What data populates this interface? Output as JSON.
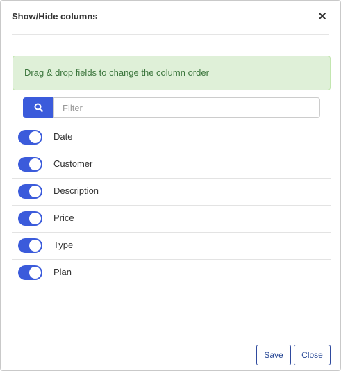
{
  "modal": {
    "title": "Show/Hide columns",
    "close_icon": "close-icon"
  },
  "alert": {
    "text": "Drag & drop fields to change the column order",
    "color": "#3c763d"
  },
  "filter": {
    "placeholder": "Filter",
    "value": "",
    "button_icon": "search-icon"
  },
  "columns": [
    {
      "label": "Date",
      "enabled": true
    },
    {
      "label": "Customer",
      "enabled": true
    },
    {
      "label": "Description",
      "enabled": true
    },
    {
      "label": "Price",
      "enabled": true
    },
    {
      "label": "Type",
      "enabled": true
    },
    {
      "label": "Plan",
      "enabled": true
    }
  ],
  "footer": {
    "save_label": "Save",
    "close_label": "Close"
  },
  "colors": {
    "accent": "#3b5bdb",
    "button_border": "#2f4a9e"
  }
}
